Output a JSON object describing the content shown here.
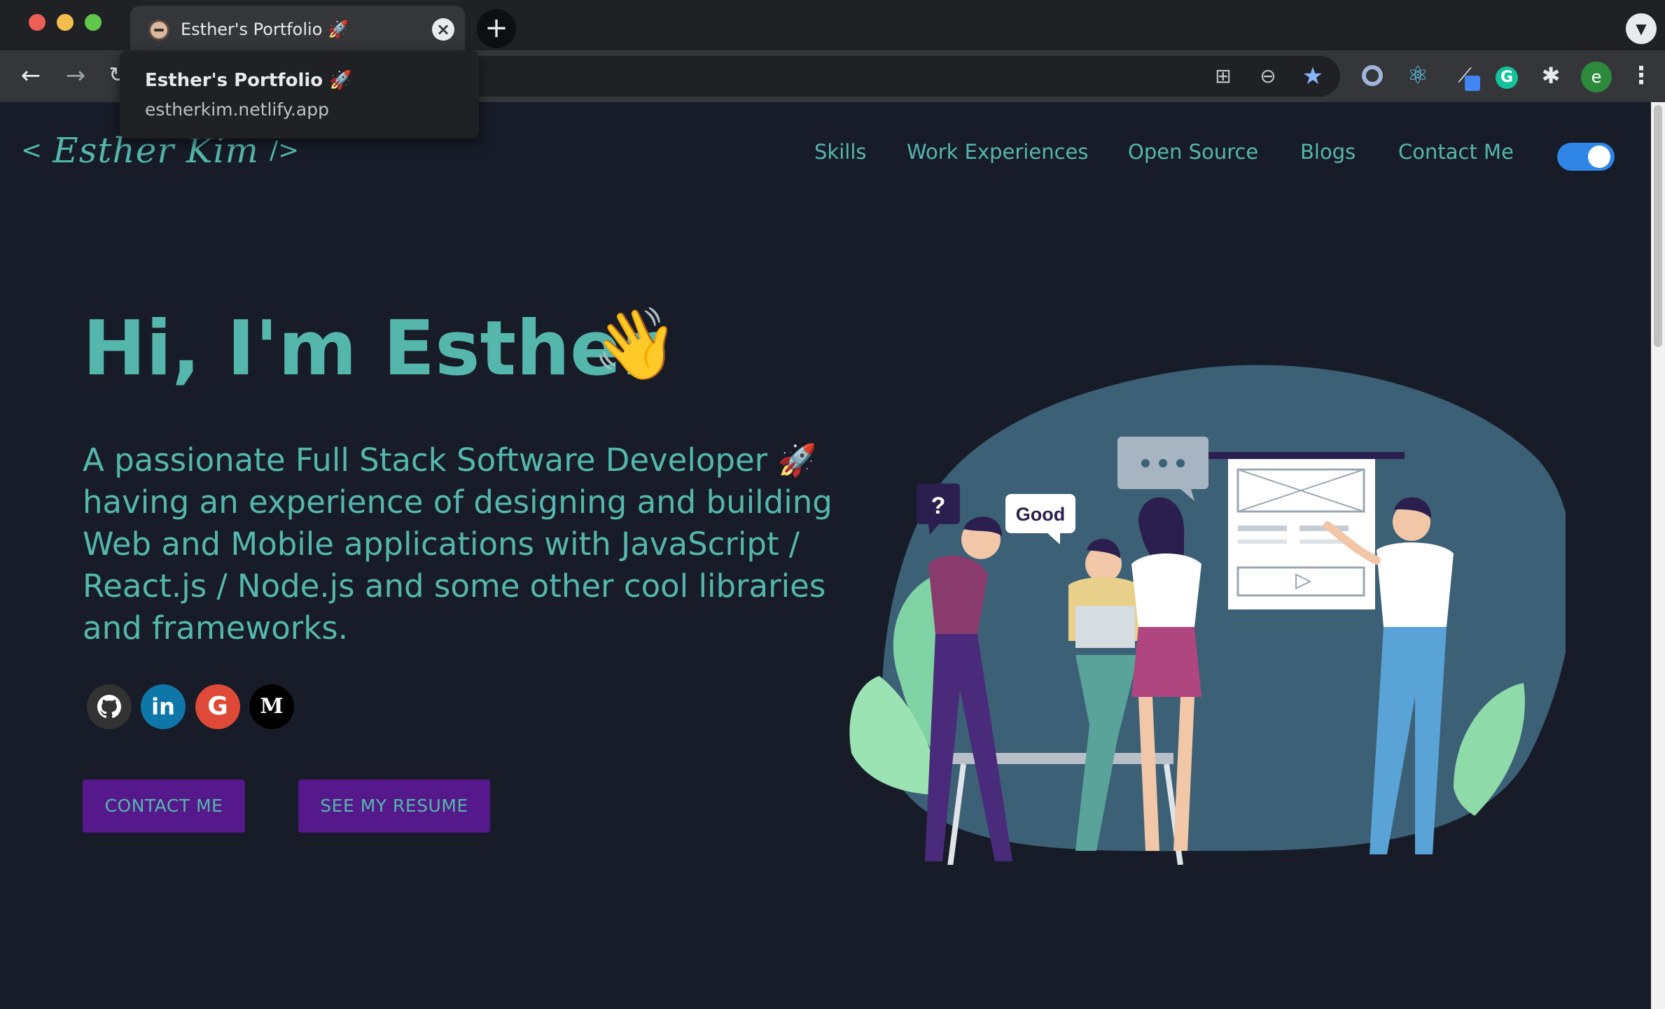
{
  "browser": {
    "tab": {
      "title": "Esther's Portfolio 🚀",
      "favicon_icon": "memoji-favicon-icon",
      "close_icon": "close-icon"
    },
    "new_tab_label": "+",
    "hovercard": {
      "title": "Esther's Portfolio 🚀",
      "url": "estherkim.netlify.app"
    },
    "toolbar": {
      "icons": [
        "back-icon",
        "forward-icon",
        "reload-icon",
        "translate-icon",
        "zoom-out-icon",
        "bookmark-star-icon"
      ],
      "extensions": [
        "disc-extension-icon",
        "react-devtools-icon",
        "eyedropper-extension-icon",
        "grammarly-icon",
        "puzzle-extensions-icon"
      ],
      "profile_initial": "e",
      "star_color": "#8ab4f8"
    }
  },
  "site": {
    "logo": {
      "open": "<",
      "name": "Esther Kim",
      "close": "/>"
    },
    "nav": [
      {
        "label": "Skills"
      },
      {
        "label": "Work Experiences"
      },
      {
        "label": "Open Source"
      },
      {
        "label": "Blogs"
      },
      {
        "label": "Contact Me"
      }
    ],
    "theme_toggle": {
      "state": "on",
      "color": "#2f86e6"
    },
    "hero": {
      "greeting": "Hi, I'm Esther",
      "wave_emoji": "👋",
      "subtitle": "A passionate Full Stack Software Developer 🚀 having an experience of designing and building Web and Mobile applications with JavaScript / React.js / Node.js and some other cool libraries and frameworks.",
      "social": [
        {
          "name": "github-icon",
          "glyph": "⌥"
        },
        {
          "name": "linkedin-icon",
          "glyph": "in"
        },
        {
          "name": "google-icon",
          "glyph": "G"
        },
        {
          "name": "medium-icon",
          "glyph": "M"
        }
      ],
      "buttons": {
        "contact": "CONTACT ME",
        "resume": "SEE MY RESUME"
      },
      "illustration": {
        "bubble_question": "?",
        "bubble_good": "Good"
      }
    },
    "colors": {
      "background": "#171c28",
      "accent": "#55b7ac",
      "button": "#55198b"
    }
  }
}
